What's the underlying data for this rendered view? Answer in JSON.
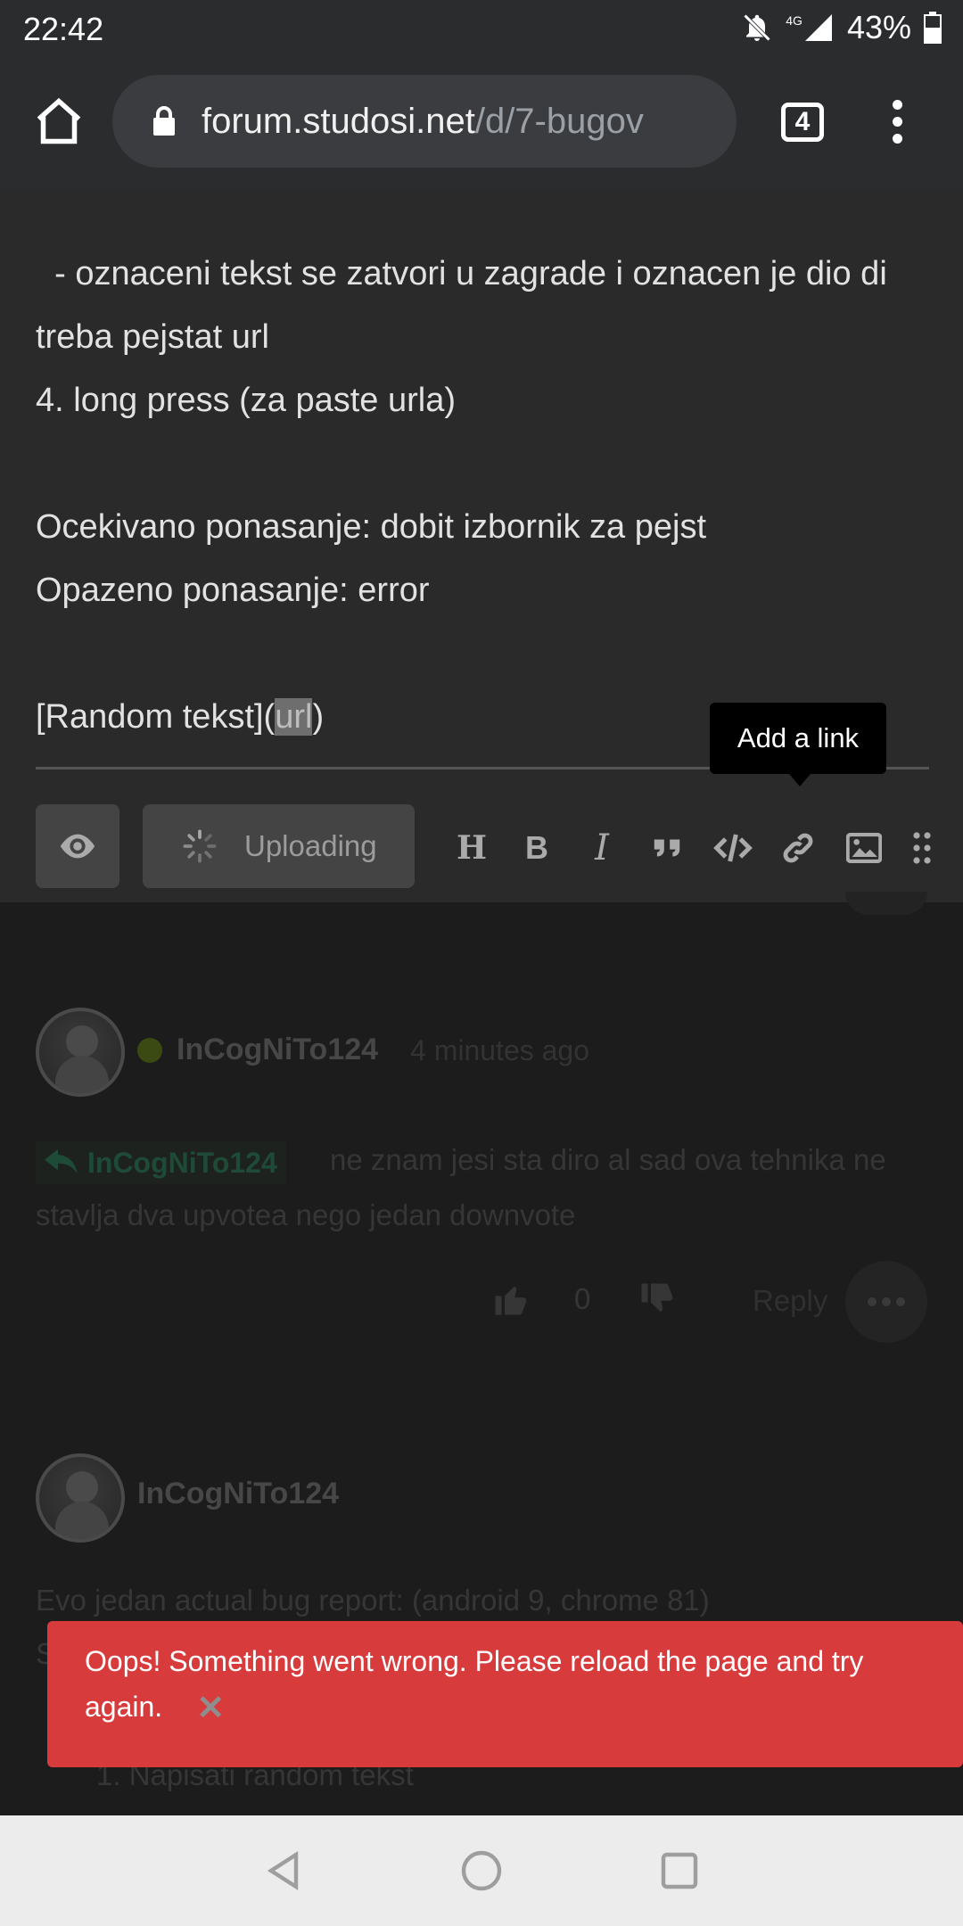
{
  "status_bar": {
    "time": "22:42",
    "network": "4G",
    "battery": "43%"
  },
  "browser": {
    "url_domain": "forum.studosi.net",
    "url_path": "/d/7-bugov",
    "tab_count": "4"
  },
  "composer": {
    "line1": "  - oznaceni tekst se zatvori u zagrade i oznacen je dio di treba pejstat url",
    "line2": "4. long press (za paste urla)",
    "line3": "Ocekivano ponasanje: dobit izbornik za pejst",
    "line4": "Opazeno ponasanje: error",
    "link_text_before": "[Random tekst](",
    "link_selected": "url",
    "link_text_after": ")",
    "tooltip": "Add a link",
    "upload_label": "Uploading",
    "tools": [
      "heading-icon",
      "bold-icon",
      "italic-icon",
      "quote-icon",
      "code-icon",
      "link-icon",
      "image-icon",
      "more-tools-icon"
    ]
  },
  "posts": [
    {
      "username": "InCogNiTo124",
      "time": "4 minutes ago",
      "reply_to": "InCogNiTo124",
      "text": "ne znam jesi sta diro al sad ova tehnika ne stavlja dva upvotea nego jedan downvote",
      "votes": "0",
      "reply_label": "Reply"
    },
    {
      "username": "InCogNiTo124",
      "text": "Evo jedan actual bug report: (android 9, chrome 81)",
      "text2": "S",
      "list_item": "1. Napisati random tekst"
    }
  ],
  "toast": {
    "message": "Oops! Something went wrong. Please reload the page and try again."
  },
  "colors": {
    "toast_bg": "#d83b3c",
    "chrome_bg": "#2b2c2e",
    "composer_bg": "#2a2a2a"
  }
}
